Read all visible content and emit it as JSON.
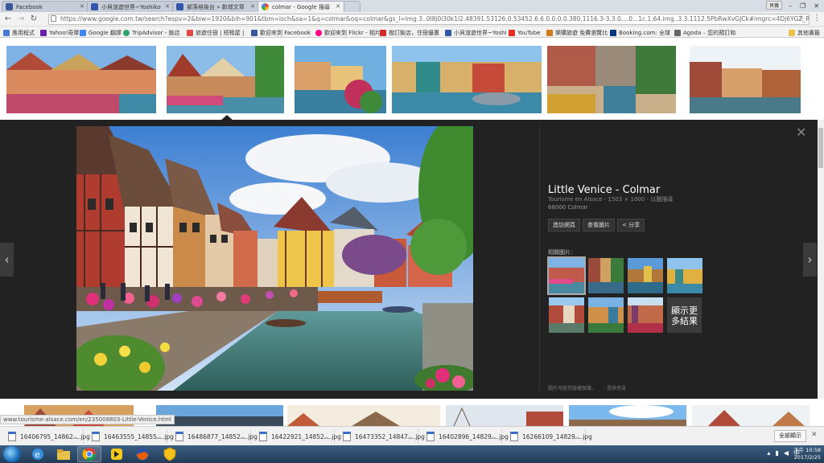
{
  "tabs": [
    {
      "label": "Facebook",
      "icon": "facebook-icon"
    },
    {
      "label": "小貝渲遊世界~Yoshiko",
      "icon": "blog-icon"
    },
    {
      "label": "部落格後台 » 新增文章",
      "icon": "blog-icon"
    },
    {
      "label": "colmar - Google 搜尋",
      "icon": "google-icon",
      "active": true
    }
  ],
  "window": {
    "user_badge": "貝薇"
  },
  "address": {
    "url": "https://www.google.com.tw/search?espv=2&biw=1920&bih=901&tbm=isch&sa=1&q=colmar&oq=colmar&gs_l=img.3..0l8j0i30k1l2.48391.53126.0.53452.6.6.0.0.0.0.380.1116.3-3.3.0....0...1c.1.64.img..3.3.1112.5PbRwXvGJCk#imgrc=4Dj6YGZ_R9E69M:"
  },
  "bookmarks": [
    {
      "label": "應用程式",
      "color": "#4a7bd0"
    },
    {
      "label": "Yahoo!奇摩",
      "color": "#6b1fa6"
    },
    {
      "label": "Google 翻譯",
      "color": "#4285f4"
    },
    {
      "label": "TripAdvisor - 飯店",
      "color": "#2fa36b"
    },
    {
      "label": "旅遊住宿 | 短租屋 |",
      "color": "#e04a4a"
    },
    {
      "label": "歡迎來到 Facebook",
      "color": "#3b5998"
    },
    {
      "label": "歡迎來到 Flickr - 相片",
      "color": "#ff0084"
    },
    {
      "label": "撥訂飯店，住宿優惠",
      "color": "#d02a2a"
    },
    {
      "label": "小貝渲遊世界~Yoshi",
      "color": "#3355aa"
    },
    {
      "label": "YouTube",
      "color": "#e52d27"
    },
    {
      "label": "樂購旅遊 免費瀏覽比",
      "color": "#d87b1f"
    },
    {
      "label": "Booking.com: 全球",
      "color": "#003580"
    },
    {
      "label": "Agoda – 您的預訂和",
      "color": "#666666"
    },
    {
      "label": "其他書籤",
      "color": "#e8c14a"
    }
  ],
  "preview": {
    "title": "Little Venice - Colmar",
    "source": "Tourisme en Alsace - 1503 × 1000 - 以圖搜尋",
    "location": "68000 Colmar",
    "buttons": [
      "造訪網頁",
      "查看圖片",
      "分享"
    ],
    "related_label": "相關圖片：",
    "more_label_1": "顯示更",
    "more_label_2": "多結果",
    "footer_note": "圖片可能受版權保護。",
    "footer_feedback": "- 提供意見"
  },
  "status_url": "www.tourisme-alsace.com/en/235008803-Little-Venice.html",
  "downloads": [
    "16406795_14862....jpg",
    "16463555_14855....jpg",
    "16486877_14852....jpg",
    "16422921_14852....jpg",
    "16473352_14847....jpg",
    "16402896_14829....jpg",
    "16266109_14829....jpg"
  ],
  "downloads_show_all": "全部顯示",
  "clock": {
    "time": "下午 10:58",
    "date": "2017/2/25"
  },
  "colors": {
    "preview_bg": "#222222",
    "taskbar": "#2a4866"
  }
}
